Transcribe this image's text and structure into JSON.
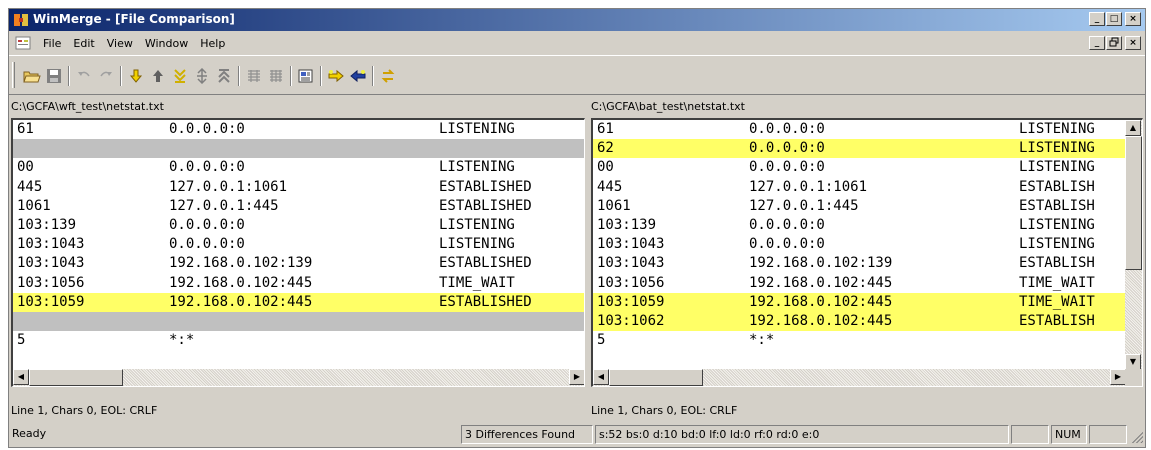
{
  "window": {
    "title": "WinMerge - [File Comparison]",
    "caption_buttons": [
      "_",
      "□",
      "×"
    ],
    "mdi_buttons": [
      "_",
      "ð",
      "×"
    ]
  },
  "menu": [
    "File",
    "Edit",
    "View",
    "Window",
    "Help"
  ],
  "toolbar": {
    "icons": [
      "open-folder-icon",
      "save-icon",
      "undo-icon",
      "redo-icon",
      "next-diff-icon",
      "prev-diff-icon",
      "last-diff-icon",
      "current-diff-icon",
      "first-diff-icon",
      "copy-all-right-icon",
      "copy-all-left-icon",
      "options-icon",
      "copy-right-icon",
      "copy-left-icon",
      "refresh-icon"
    ]
  },
  "left": {
    "path": "C:\\GCFA\\wft_test\\netstat.txt",
    "lines": [
      {
        "state": "normal",
        "c1": "61",
        "c2": "0.0.0.0:0",
        "c3": "LISTENING"
      },
      {
        "state": "blank",
        "c1": "",
        "c2": "",
        "c3": ""
      },
      {
        "state": "normal",
        "c1": "00",
        "c2": "0.0.0.0:0",
        "c3": "LISTENING"
      },
      {
        "state": "normal",
        "c1": "445",
        "c2": "127.0.0.1:1061",
        "c3": "ESTABLISHED"
      },
      {
        "state": "normal",
        "c1": "1061",
        "c2": "127.0.0.1:445",
        "c3": "ESTABLISHED"
      },
      {
        "state": "normal",
        "c1": "103:139",
        "c2": "0.0.0.0:0",
        "c3": "LISTENING"
      },
      {
        "state": "normal",
        "c1": "103:1043",
        "c2": "0.0.0.0:0",
        "c3": "LISTENING"
      },
      {
        "state": "normal",
        "c1": "103:1043",
        "c2": "192.168.0.102:139",
        "c3": "ESTABLISHED"
      },
      {
        "state": "normal",
        "c1": "103:1056",
        "c2": "192.168.0.102:445",
        "c3": "TIME_WAIT"
      },
      {
        "state": "diff",
        "c1": "103:1059",
        "c2": "192.168.0.102:445",
        "c3": "ESTABLISHED"
      },
      {
        "state": "blank",
        "c1": "",
        "c2": "",
        "c3": ""
      },
      {
        "state": "normal",
        "c1": "5",
        "c2": "*:*",
        "c3": ""
      }
    ],
    "status": "Line 1, Chars 0, EOL: CRLF"
  },
  "right": {
    "path": "C:\\GCFA\\bat_test\\netstat.txt",
    "lines": [
      {
        "state": "normal",
        "c1": "61",
        "c2": "0.0.0.0:0",
        "c3": "LISTENING"
      },
      {
        "state": "diff",
        "c1": "62",
        "c2": "0.0.0.0:0",
        "c3": "LISTENING"
      },
      {
        "state": "normal",
        "c1": "00",
        "c2": "0.0.0.0:0",
        "c3": "LISTENING"
      },
      {
        "state": "normal",
        "c1": "445",
        "c2": "127.0.0.1:1061",
        "c3": "ESTABLISH"
      },
      {
        "state": "normal",
        "c1": "1061",
        "c2": "127.0.0.1:445",
        "c3": "ESTABLISH"
      },
      {
        "state": "normal",
        "c1": "103:139",
        "c2": "0.0.0.0:0",
        "c3": "LISTENING"
      },
      {
        "state": "normal",
        "c1": "103:1043",
        "c2": "0.0.0.0:0",
        "c3": "LISTENING"
      },
      {
        "state": "normal",
        "c1": "103:1043",
        "c2": "192.168.0.102:139",
        "c3": "ESTABLISH"
      },
      {
        "state": "normal",
        "c1": "103:1056",
        "c2": "192.168.0.102:445",
        "c3": "TIME_WAIT"
      },
      {
        "state": "diff",
        "c1": "103:1059",
        "c2": "192.168.0.102:445",
        "c3": "TIME_WAIT"
      },
      {
        "state": "diff",
        "c1": "103:1062",
        "c2": "192.168.0.102:445",
        "c3": "ESTABLISH"
      },
      {
        "state": "normal",
        "c1": "5",
        "c2": "*:*",
        "c3": ""
      }
    ],
    "status": "Line 1, Chars 0, EOL: CRLF"
  },
  "statusbar": {
    "ready": "Ready",
    "differences": "3 Differences Found",
    "stats": "s:52 bs:0 d:10 bd:0 lf:0 ld:0 rf:0 rd:0 e:0",
    "empty": "",
    "num": "NUM",
    "empty2": ""
  },
  "colors": {
    "diff": "#ffff66",
    "blank": "#c0c0c0",
    "titlebar_start": "#0a246a",
    "titlebar_end": "#a6caf0",
    "chrome": "#d4d0c8"
  }
}
